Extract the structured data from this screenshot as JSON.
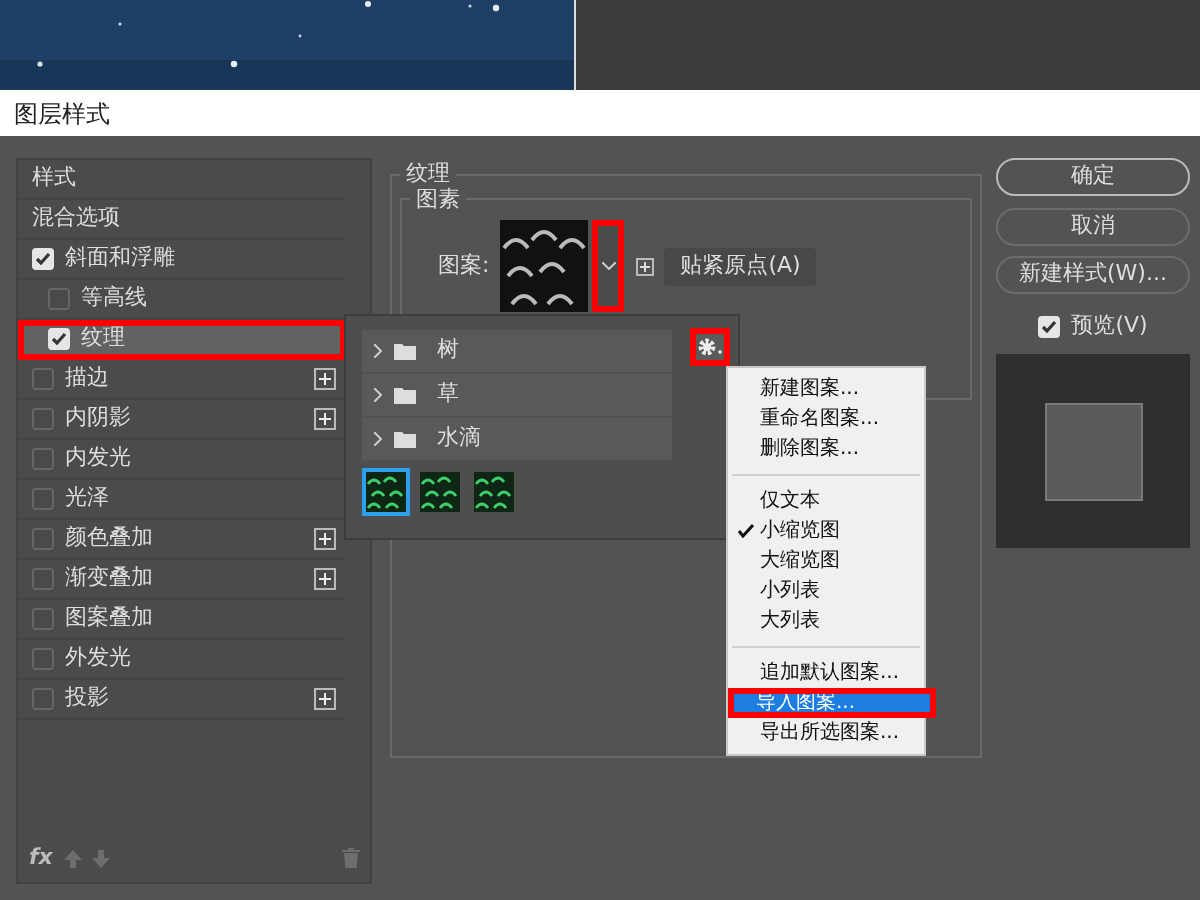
{
  "window": {
    "title": "图层样式"
  },
  "styles_list": {
    "items": [
      {
        "label": "样式",
        "kind": "header",
        "selected": false
      },
      {
        "label": "混合选项",
        "kind": "header",
        "selected": false
      },
      {
        "label": "斜面和浮雕",
        "kind": "checkbox",
        "checked": true,
        "selected": false,
        "can_add": false,
        "children": [
          {
            "label": "等高线",
            "kind": "checkbox",
            "checked": false,
            "selected": false,
            "can_add": false
          },
          {
            "label": "纹理",
            "kind": "checkbox",
            "checked": true,
            "selected": true,
            "can_add": false,
            "annotated": true
          }
        ]
      },
      {
        "label": "描边",
        "kind": "checkbox",
        "checked": false,
        "selected": false,
        "can_add": true
      },
      {
        "label": "内阴影",
        "kind": "checkbox",
        "checked": false,
        "selected": false,
        "can_add": true
      },
      {
        "label": "内发光",
        "kind": "checkbox",
        "checked": false,
        "selected": false,
        "can_add": false
      },
      {
        "label": "光泽",
        "kind": "checkbox",
        "checked": false,
        "selected": false,
        "can_add": false
      },
      {
        "label": "颜色叠加",
        "kind": "checkbox",
        "checked": false,
        "selected": false,
        "can_add": true
      },
      {
        "label": "渐变叠加",
        "kind": "checkbox",
        "checked": false,
        "selected": false,
        "can_add": true
      },
      {
        "label": "图案叠加",
        "kind": "checkbox",
        "checked": false,
        "selected": false,
        "can_add": false
      },
      {
        "label": "外发光",
        "kind": "checkbox",
        "checked": false,
        "selected": false,
        "can_add": false
      },
      {
        "label": "投影",
        "kind": "checkbox",
        "checked": false,
        "selected": false,
        "can_add": true
      }
    ],
    "fx": "fx"
  },
  "texture": {
    "group_title": "纹理",
    "subgroup_title": "图素",
    "pattern_label": "图案:",
    "dropdown_annotated": true,
    "snap_button": "贴紧原点(A)"
  },
  "pattern_picker": {
    "gear_annotated": true,
    "folders": [
      {
        "name": "树",
        "expanded": false
      },
      {
        "name": "草",
        "expanded": false
      },
      {
        "name": "水滴",
        "expanded": false
      }
    ],
    "swatches": [
      {
        "selected": true
      },
      {
        "selected": false
      },
      {
        "selected": false
      }
    ]
  },
  "menu": {
    "items": [
      {
        "kind": "item",
        "label": "新建图案...",
        "checked": false,
        "selected": false
      },
      {
        "kind": "item",
        "label": "重命名图案...",
        "checked": false,
        "selected": false
      },
      {
        "kind": "item",
        "label": "删除图案...",
        "checked": false,
        "selected": false
      },
      {
        "kind": "separator"
      },
      {
        "kind": "item",
        "label": "仅文本",
        "checked": false,
        "selected": false
      },
      {
        "kind": "item",
        "label": "小缩览图",
        "checked": true,
        "selected": false
      },
      {
        "kind": "item",
        "label": "大缩览图",
        "checked": false,
        "selected": false
      },
      {
        "kind": "item",
        "label": "小列表",
        "checked": false,
        "selected": false
      },
      {
        "kind": "item",
        "label": "大列表",
        "checked": false,
        "selected": false
      },
      {
        "kind": "separator"
      },
      {
        "kind": "item",
        "label": "追加默认图案...",
        "checked": false,
        "selected": false
      },
      {
        "kind": "item",
        "label": "导入图案...",
        "checked": false,
        "selected": true,
        "annotated": true
      },
      {
        "kind": "item",
        "label": "导出所选图案...",
        "checked": false,
        "selected": false
      }
    ]
  },
  "buttons": [
    {
      "label": "确定",
      "default": true
    },
    {
      "label": "取消",
      "default": false
    },
    {
      "label": "新建样式(W)...",
      "default": false
    }
  ],
  "preview": {
    "label": "预览(V)",
    "checked": true
  }
}
